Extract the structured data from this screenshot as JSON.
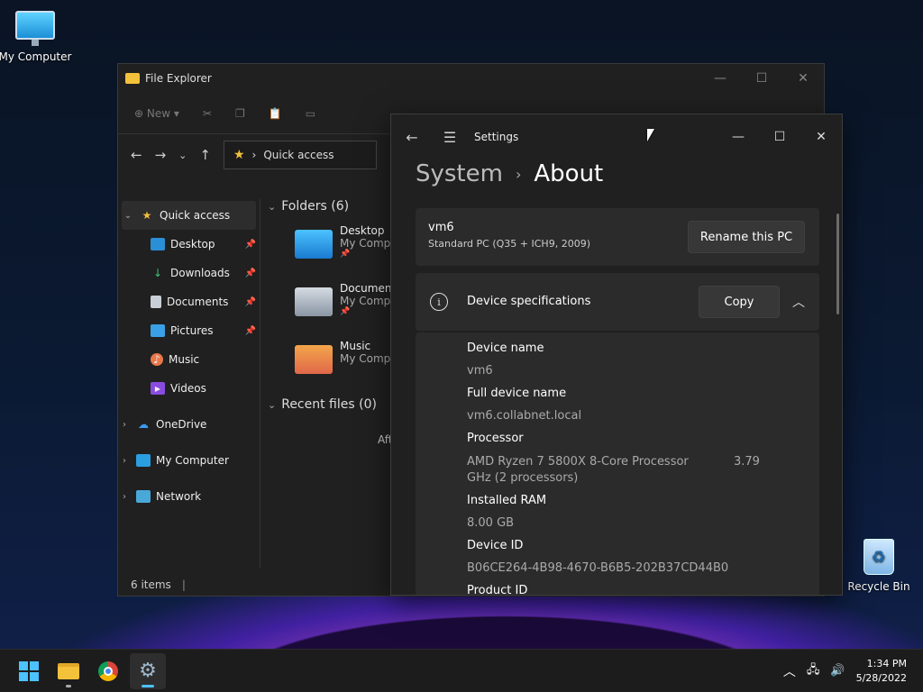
{
  "desktop": {
    "icons": [
      {
        "label": "My Computer"
      },
      {
        "label": "Recycle Bin"
      }
    ]
  },
  "explorer": {
    "title": "File Explorer",
    "toolbar": {
      "new_label": "New"
    },
    "address": {
      "location": "Quick access"
    },
    "nav": {
      "quick_access": "Quick access",
      "items": [
        "Desktop",
        "Downloads",
        "Documents",
        "Pictures",
        "Music",
        "Videos"
      ],
      "onedrive": "OneDrive",
      "my_computer": "My Computer",
      "network": "Network"
    },
    "content": {
      "folders_header": "Folders (6)",
      "folders": [
        {
          "name": "Desktop",
          "location": "My Computer"
        },
        {
          "name": "Documents",
          "location": "My Computer"
        },
        {
          "name": "Music",
          "location": "My Computer"
        }
      ],
      "recent_header": "Recent files (0)",
      "recent_partial": "Aft"
    },
    "status": {
      "items": "6 items"
    }
  },
  "settings": {
    "title": "Settings",
    "breadcrumb": {
      "root": "System",
      "page": "About"
    },
    "pc": {
      "name": "vm6",
      "model": "Standard PC (Q35 + ICH9, 2009)",
      "rename_label": "Rename this PC"
    },
    "specs": {
      "header": "Device specifications",
      "copy_label": "Copy",
      "rows": [
        {
          "key": "Device name",
          "value": "vm6"
        },
        {
          "key": "Full device name",
          "value": "vm6.collabnet.local"
        },
        {
          "key": "Processor",
          "value": "AMD Ryzen 7 5800X 8-Core Processor",
          "value_extra": "3.79",
          "value_line2": "GHz  (2 processors)"
        },
        {
          "key": "Installed RAM",
          "value": "8.00 GB"
        },
        {
          "key": "Device ID",
          "value": "B06CE264-4B98-4670-B6B5-202B37CD44B0"
        },
        {
          "key": "Product ID",
          "value": ""
        }
      ]
    }
  },
  "taskbar": {
    "time": "1:34 PM",
    "date": "5/28/2022"
  },
  "colors": {
    "accent": "#4cc2ff",
    "folder": "#f3c13a"
  }
}
